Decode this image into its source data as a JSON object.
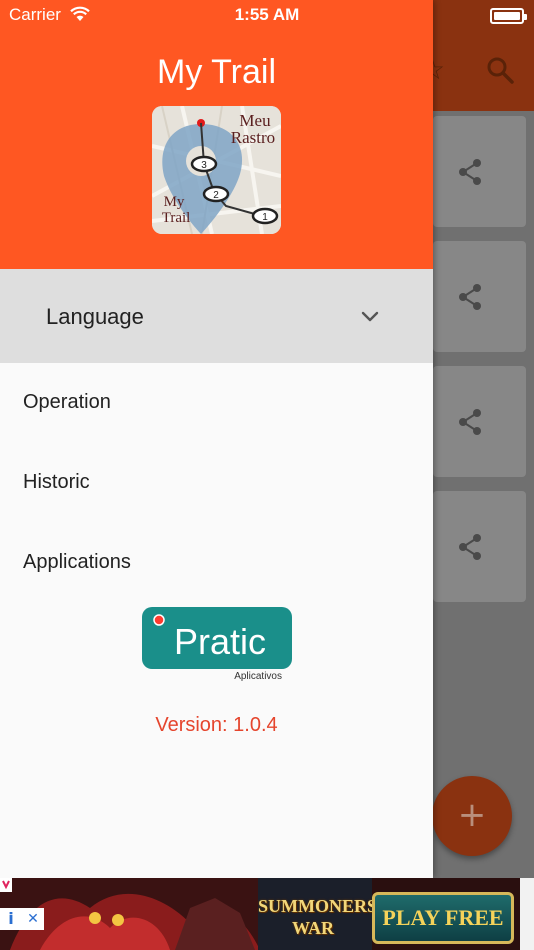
{
  "status_bar": {
    "carrier": "Carrier",
    "time": "1:55 AM"
  },
  "drawer": {
    "title": "My Trail",
    "logo": {
      "line1": "Meu",
      "line2": "Rastro",
      "line3": "My",
      "line4": "Trail"
    },
    "language_label": "Language",
    "menu_items": [
      {
        "label": "Operation"
      },
      {
        "label": "Historic"
      },
      {
        "label": "Applications"
      }
    ],
    "brand_logo": {
      "name": "Pratic",
      "tagline": "Aplicativos"
    },
    "version": "Version: 1.0.4"
  },
  "fab": {
    "label": "+"
  },
  "ad": {
    "game_line1": "SUMMONERS",
    "game_line2": "WAR",
    "cta": "PLAY FREE"
  },
  "colors": {
    "primary": "#ff5722",
    "version_text": "#e5452d",
    "pratic_teal": "#1a8f8a"
  }
}
